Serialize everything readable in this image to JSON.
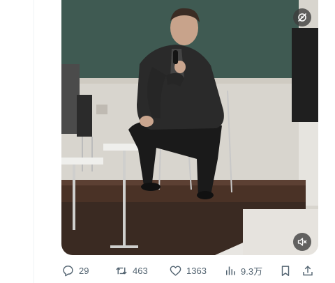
{
  "post": {
    "media": {
      "type": "video",
      "autoplay_icon": "autoplay-off-icon",
      "mute_icon": "muted-speaker-icon"
    },
    "actions": {
      "reply": {
        "icon": "reply-icon",
        "count": "29"
      },
      "repost": {
        "icon": "repost-icon",
        "count": "463"
      },
      "like": {
        "icon": "heart-icon",
        "count": "1363"
      },
      "views": {
        "icon": "views-chart-icon",
        "count": "9.3万"
      },
      "bookmark": {
        "icon": "bookmark-icon"
      },
      "share": {
        "icon": "share-icon"
      }
    }
  },
  "colors": {
    "action_gray": "#536471",
    "divider": "#eff3f4"
  }
}
